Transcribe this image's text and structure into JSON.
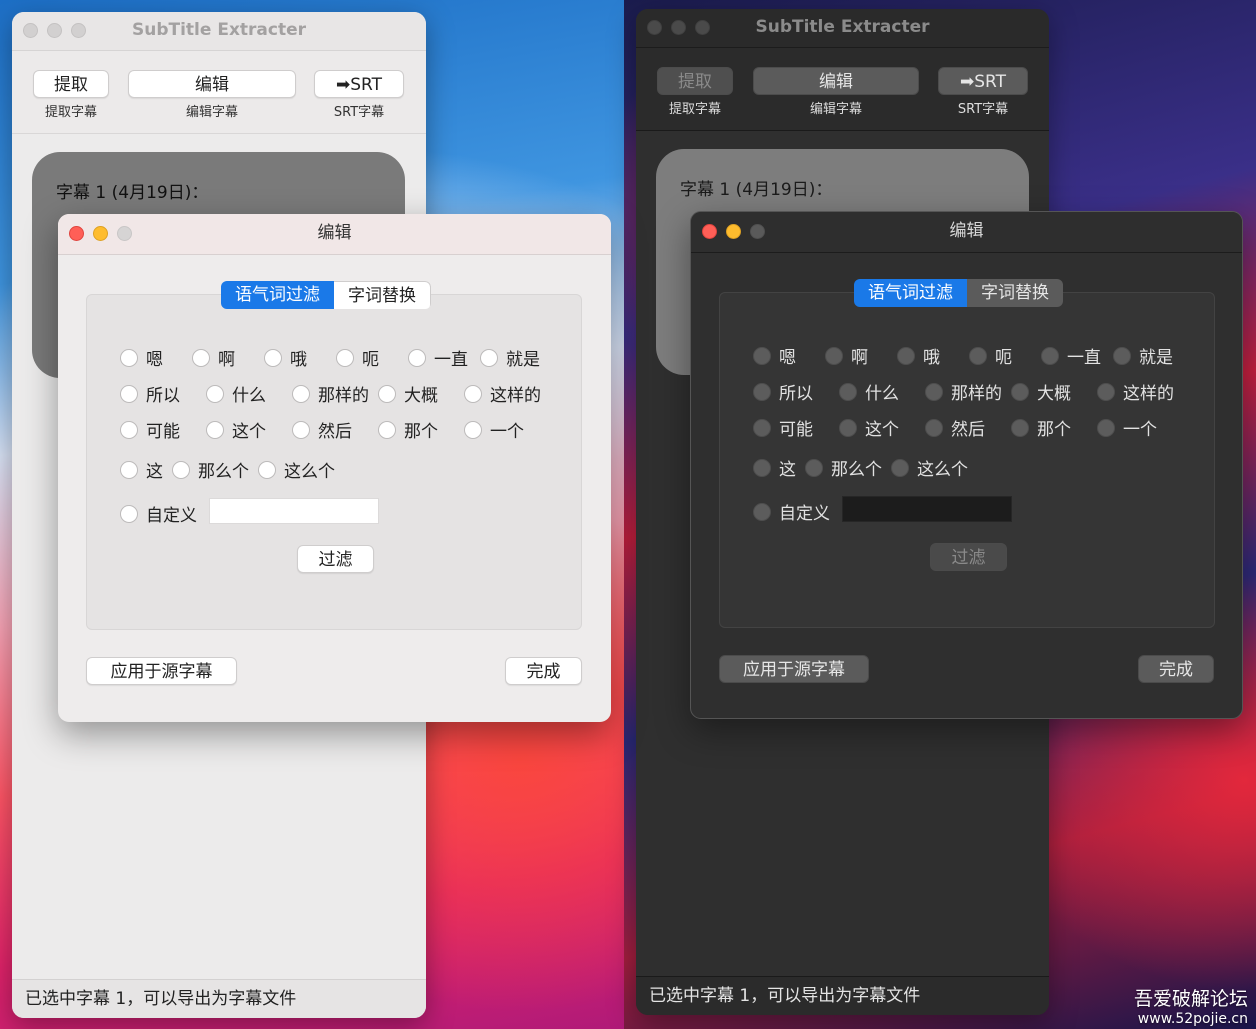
{
  "main_window": {
    "title": "SubTitle Extracter",
    "toolbar": [
      {
        "button": "提取",
        "label": "提取字幕"
      },
      {
        "button": "编辑",
        "label": "编辑字幕"
      },
      {
        "button": "➡SRT",
        "label": "SRT字幕"
      }
    ],
    "subtitle_entry": "字幕 1 (4月19日)：",
    "status": "已选中字幕 1，可以导出为字幕文件"
  },
  "dialog": {
    "title": "编辑",
    "tabs": [
      "语气词过滤",
      "字词替换"
    ],
    "active_tab": "语气词过滤",
    "filter_rows": [
      [
        "嗯",
        "啊",
        "哦",
        "呃",
        "一直",
        "就是"
      ],
      [
        "所以",
        "什么",
        "那样的",
        "大概",
        "这样的"
      ],
      [
        "可能",
        "这个",
        "然后",
        "那个",
        "一个"
      ],
      [
        "这",
        "那么个",
        "这么个"
      ]
    ],
    "custom_label": "自定义",
    "custom_value": "",
    "filter_button": "过滤",
    "apply_button": "应用于源字幕",
    "done_button": "完成"
  },
  "watermark": {
    "site_name": "吾爱破解论坛",
    "url": "www.52pojie.cn"
  },
  "colors": {
    "accent": "#1a79e8",
    "close": "#ff5f57",
    "minimize": "#febc2e"
  }
}
